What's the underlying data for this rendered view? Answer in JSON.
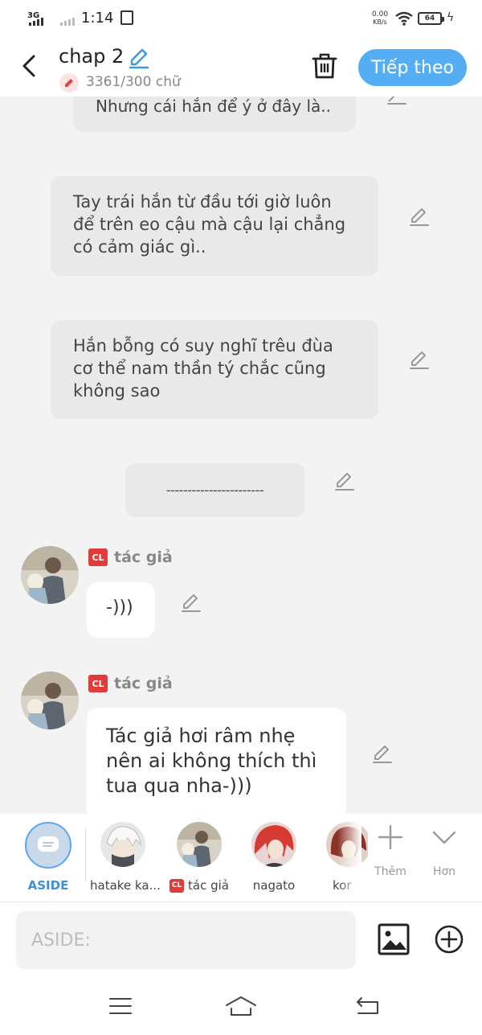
{
  "status_bar": {
    "network": "3G",
    "time": "1:14",
    "speed_value": "0.00",
    "speed_unit": "KB/s",
    "battery": "64"
  },
  "header": {
    "title": "chap 2",
    "word_count": "3361/300 chữ",
    "next_label": "Tiếp theo"
  },
  "messages": {
    "m0": "Nhưng cái hắn để ý ở đây là..",
    "m1": "Tay trái hắn từ đầu tới giờ luôn để trên eo cậu mà cậu lại chẳng có cảm giác gì..",
    "m2": "Hắn bỗng có suy nghĩ trêu đùa cơ thể nam thần tý chắc cũng không sao",
    "m3": "-----------------------",
    "m4_name": "tác giả",
    "m4_text": "-)))",
    "m5_name": "tác giả",
    "m5_text": "Tác giả hơi râm nhẹ nên ai không thích thì tua qua nha-)))"
  },
  "badge": "CL",
  "characters": {
    "aside": "ASIDE",
    "hatake": "hatake ka...",
    "tacgia": "tác giả",
    "nagato": "nagato",
    "partial": "kor",
    "more_label": "Thêm",
    "collapse_label": "Hơn"
  },
  "input": {
    "placeholder": "ASIDE:"
  },
  "colors": {
    "accent": "#55aef4",
    "badge_red": "#e03c3c",
    "bubble_gray": "#e9e9e9",
    "background": "#f3f3f3"
  }
}
